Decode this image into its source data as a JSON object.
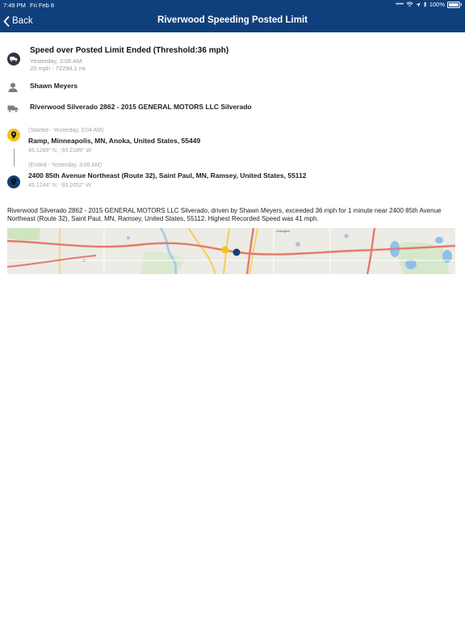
{
  "status_bar": {
    "time": "7:49 PM",
    "date": "Fri Feb 8",
    "battery": "100%"
  },
  "nav": {
    "back_label": "Back",
    "title": "Riverwood Speeding Posted Limit"
  },
  "event": {
    "title": "Speed over Posted Limit Ended (Threshold:36 mph)",
    "time": "Yesterday, 3:05 AM",
    "details": "20 mph - 72294.1 mi"
  },
  "driver": {
    "name": "Shawn Meyers"
  },
  "vehicle": {
    "name": "Riverwood Silverado 2862 - 2015 GENERAL MOTORS LLC Silverado"
  },
  "start": {
    "label": "(Started - Yesterday, 3:04 AM)",
    "address": "Ramp, Minneapolis, MN, Anoka, United States, 55449",
    "coords": "45.1269° N, -93.2189° W"
  },
  "end": {
    "label": "(Ended - Yesterday, 3:06 AM)",
    "address": "2400 85th Avenue Northeast  (Route 32), Saint Paul, MN, Ramsey, United States, 55112",
    "coords": "45.1244° N, -93.2052° W"
  },
  "summary": "Riverwood Silverado 2862 - 2015 GENERAL MOTORS LLC Silverado, driven by Shawn Meyers, exceeded 36 mph for 1 minute near 2400 85th Avenue Northeast  (Route 32), Saint Paul, MN, Ramsey, United States, 55112. Highest Recorded Speed was 41 mph.",
  "map": {
    "labels": [
      "Lexington"
    ]
  },
  "colors": {
    "nav_bar": "#0f3f7c",
    "start_pin": "#f4c21f",
    "end_pin": "#123f72",
    "road": "#e57a6c"
  },
  "icons": {
    "event": "truck-icon",
    "driver": "person-icon",
    "vehicle": "truck-icon",
    "start": "map-pin-icon",
    "end": "map-pin-icon"
  }
}
